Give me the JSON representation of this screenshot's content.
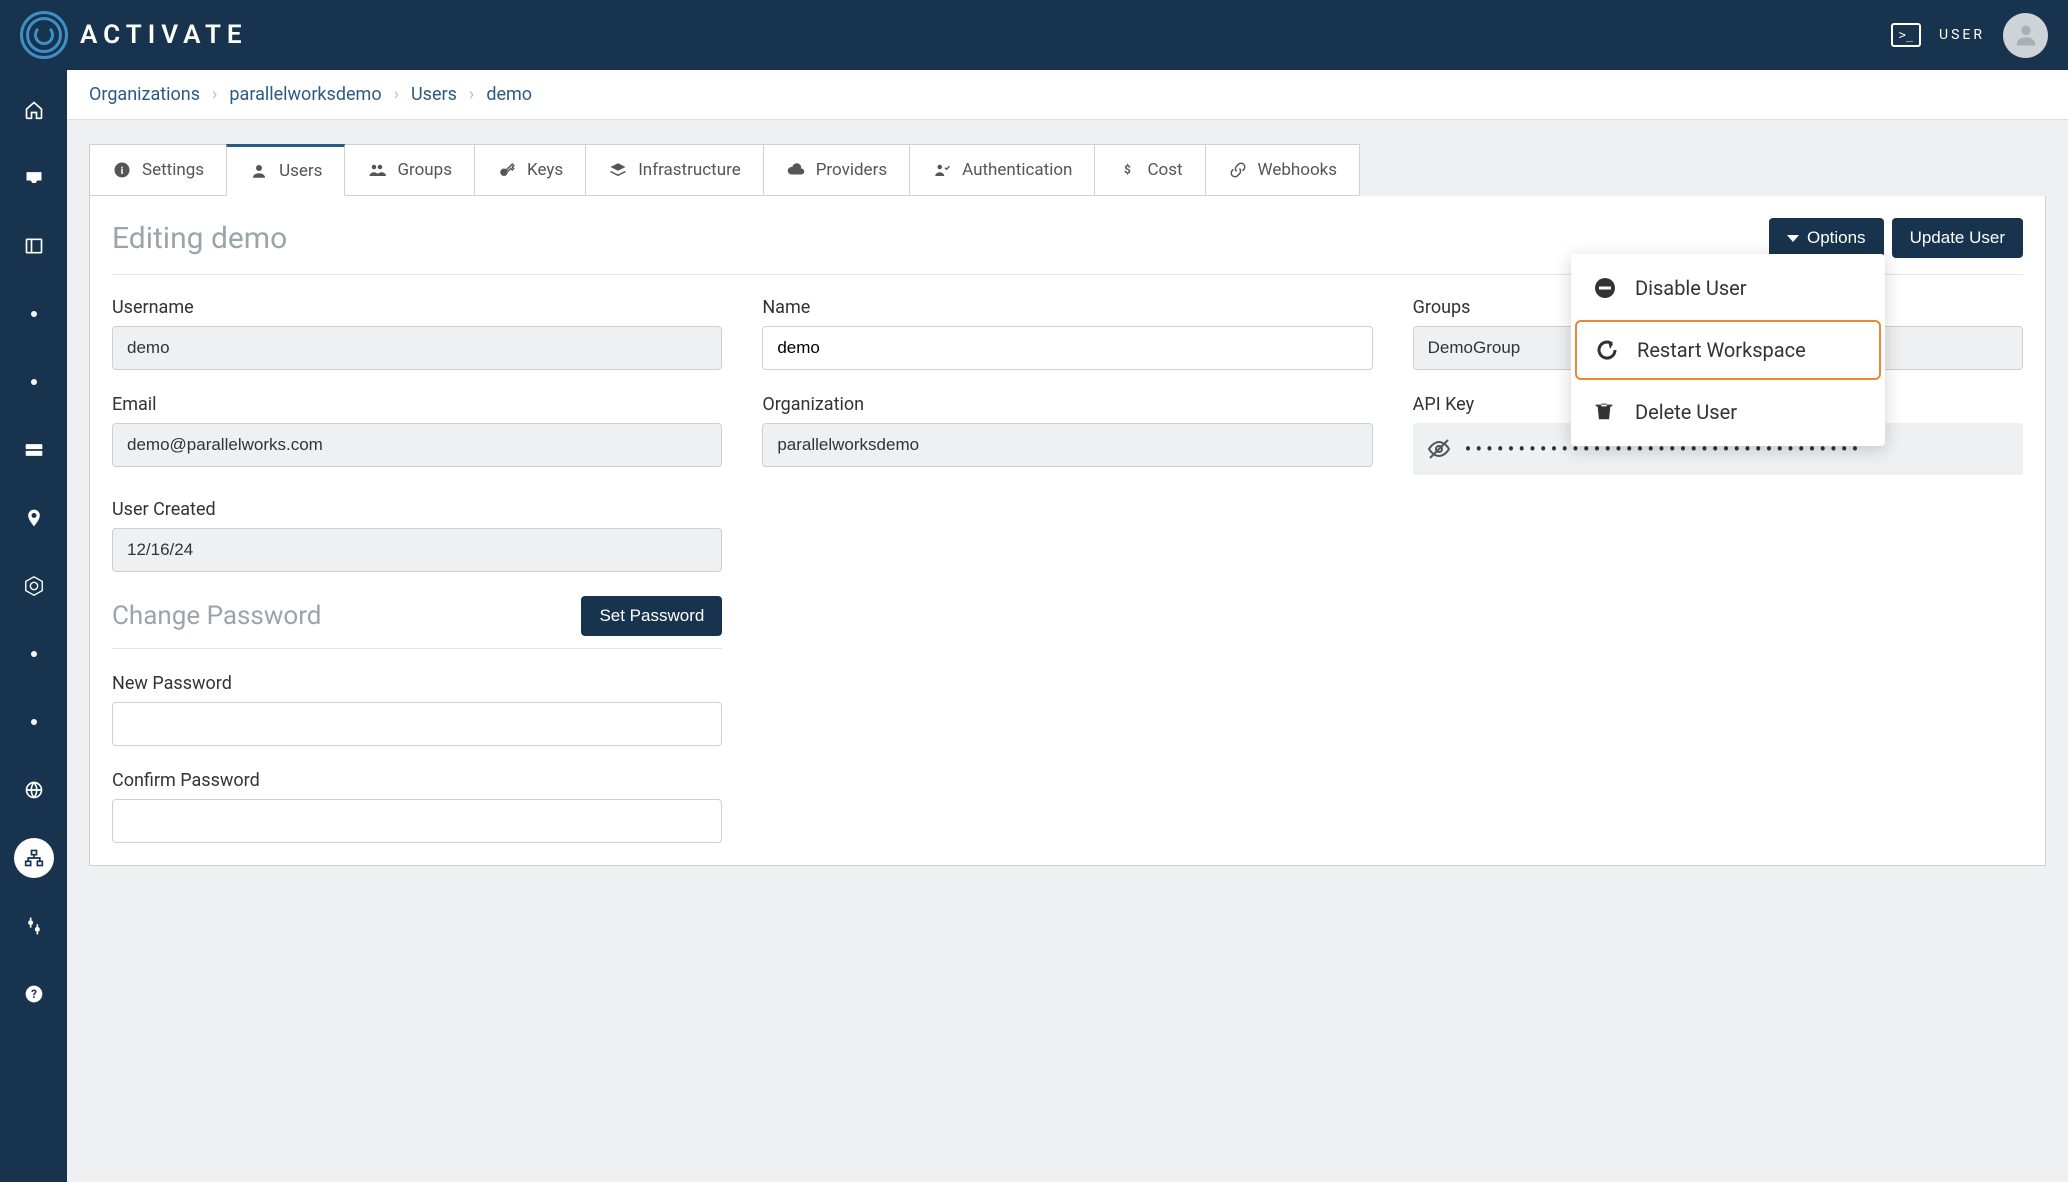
{
  "header": {
    "brand": "ACTIVATE",
    "user_label": "USER"
  },
  "breadcrumbs": [
    "Organizations",
    "parallelworksdemo",
    "Users",
    "demo"
  ],
  "tabs": [
    {
      "label": "Settings"
    },
    {
      "label": "Users"
    },
    {
      "label": "Groups"
    },
    {
      "label": "Keys"
    },
    {
      "label": "Infrastructure"
    },
    {
      "label": "Providers"
    },
    {
      "label": "Authentication"
    },
    {
      "label": "Cost"
    },
    {
      "label": "Webhooks"
    }
  ],
  "panel": {
    "title": "Editing demo",
    "options_btn": "Options",
    "update_btn": "Update User"
  },
  "fields": {
    "username_label": "Username",
    "username_value": "demo",
    "name_label": "Name",
    "name_value": "demo",
    "groups_label": "Groups",
    "groups_value": "DemoGroup",
    "email_label": "Email",
    "email_value": "demo@parallelworks.com",
    "org_label": "Organization",
    "org_value": "parallelworksdemo",
    "apikey_label": "API Key",
    "apikey_masked": "•••••••••••••••••••••••••••••••••••••",
    "created_label": "User Created",
    "created_value": "12/16/24",
    "change_pw_title": "Change Password",
    "set_pw_btn": "Set Password",
    "new_pw_label": "New Password",
    "confirm_pw_label": "Confirm Password"
  },
  "dropdown": {
    "disable": "Disable User",
    "restart": "Restart Workspace",
    "delete": "Delete User"
  }
}
